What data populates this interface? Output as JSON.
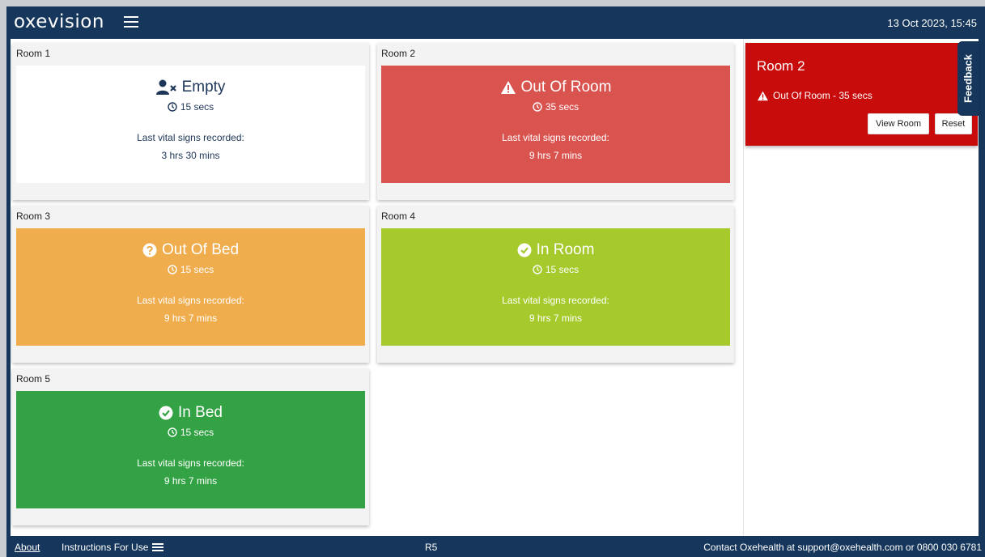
{
  "header": {
    "logo": "oxevision",
    "datetime": "13 Oct 2023, 15:45"
  },
  "rooms": [
    {
      "title": "Room 1",
      "status": "Empty",
      "timer": "15 secs",
      "vital_label": "Last vital signs recorded:",
      "vital_value": "3 hrs 30 mins",
      "status_icon": "user-times-icon",
      "color": "#ffffff",
      "text_color": "#1d3557"
    },
    {
      "title": "Room 2",
      "status": "Out Of Room",
      "timer": "35 secs",
      "vital_label": "Last vital signs recorded:",
      "vital_value": "9 hrs 7 mins",
      "status_icon": "warning-icon",
      "color": "#d9534f",
      "text_color": "#ffffff"
    },
    {
      "title": "Room 3",
      "status": "Out Of Bed",
      "timer": "15 secs",
      "vital_label": "Last vital signs recorded:",
      "vital_value": "9 hrs 7 mins",
      "status_icon": "question-circle-icon",
      "color": "#f0ad4e",
      "text_color": "#ffffff"
    },
    {
      "title": "Room 4",
      "status": "In Room",
      "timer": "15 secs",
      "vital_label": "Last vital signs recorded:",
      "vital_value": "9 hrs 7 mins",
      "status_icon": "check-circle-icon",
      "color": "#a6c92b",
      "text_color": "#ffffff"
    },
    {
      "title": "Room 5",
      "status": "In Bed",
      "timer": "15 secs",
      "vital_label": "Last vital signs recorded:",
      "vital_value": "9 hrs 7 mins",
      "status_icon": "check-circle-icon",
      "color": "#33a244",
      "text_color": "#ffffff"
    }
  ],
  "alert": {
    "title": "Room 2",
    "message": "Out Of Room - 35 secs",
    "view_button": "View Room",
    "reset_button": "Reset",
    "color": "#c80b0b"
  },
  "feedback": {
    "label": "Feedback"
  },
  "footer": {
    "about": "About",
    "instructions": "Instructions For Use",
    "ref": "R5",
    "contact": "Contact Oxehealth at support@oxehealth.com or 0800 030 6781"
  },
  "colors": {
    "brand": "#16375b"
  }
}
